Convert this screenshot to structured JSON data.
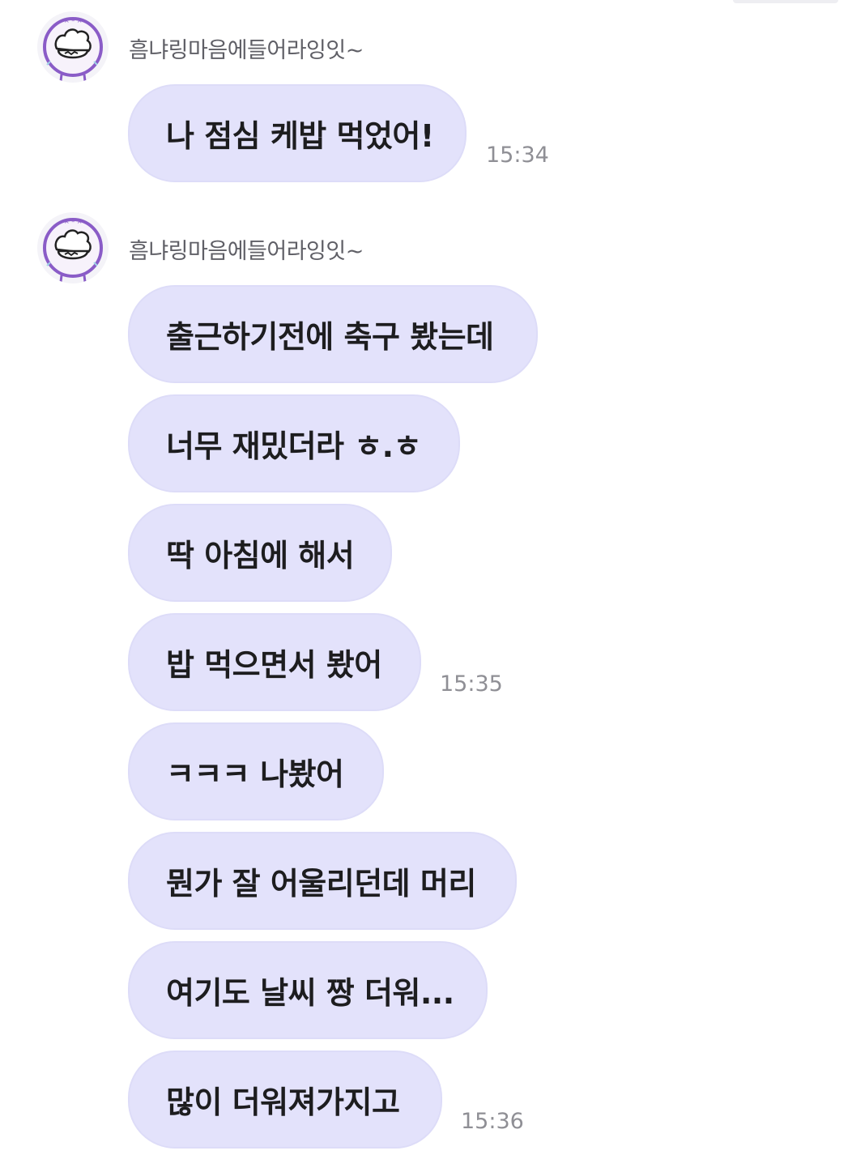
{
  "chat": {
    "groups": [
      {
        "sender": "흠냐링마음에들어라잉잇~",
        "messages": [
          {
            "text": "나 점심 케밥 먹었어!",
            "time": "15:34"
          }
        ]
      },
      {
        "sender": "흠냐링마음에들어라잉잇~",
        "messages": [
          {
            "text": "출근하기전에 축구 봤는데",
            "time": ""
          },
          {
            "text": "너무 재밌더라 ㅎ.ㅎ",
            "time": ""
          },
          {
            "text": "딱 아침에 해서",
            "time": ""
          },
          {
            "text": "밥 먹으면서 봤어",
            "time": "15:35"
          },
          {
            "text": "ㅋㅋㅋ 나봤어",
            "time": ""
          },
          {
            "text": "뭔가 잘 어울리던데 머리",
            "time": ""
          },
          {
            "text": "여기도 날씨 짱 더워...",
            "time": ""
          },
          {
            "text": "많이 더워져가지고",
            "time": "15:36"
          }
        ]
      }
    ],
    "avatar_icon": "sticker-face-avatar-icon",
    "colors": {
      "bubble": "#e3e2fb",
      "bubble_border": "#dddcf8",
      "avatar_ring": "#8a5cc7",
      "sender_text": "#5f5f66",
      "time_text": "#8f8f95"
    }
  }
}
